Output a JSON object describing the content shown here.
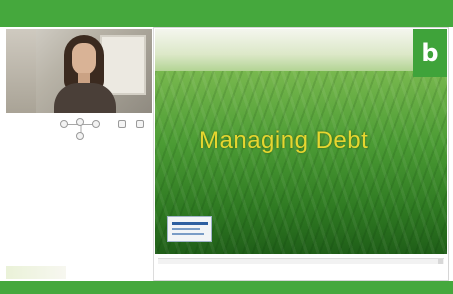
{
  "slide": {
    "title": "Managing Debt",
    "brand_letter": "b"
  },
  "colors": {
    "accent_green": "#45a83d",
    "title_yellow": "#e6d630"
  }
}
